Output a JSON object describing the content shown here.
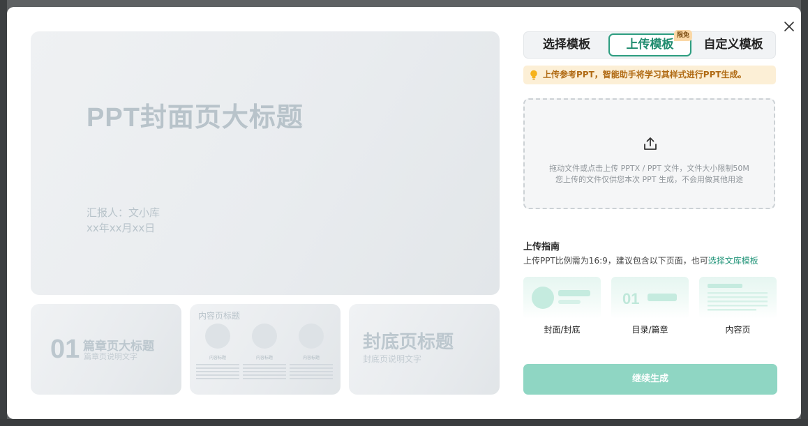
{
  "preview": {
    "cover_title": "PPT封面页大标题",
    "cover_reporter": "汇报人：文小库",
    "cover_date": "xx年xx月xx日",
    "chapter_num": "01",
    "chapter_title": "篇章页大标题",
    "chapter_sub": "篇章页说明文字",
    "content_title": "内容页标题",
    "content_caption": "内容标题",
    "back_title": "封底页标题",
    "back_sub": "封底页说明文字"
  },
  "tabs": {
    "select": "选择模板",
    "upload": "上传模板",
    "custom": "自定义模板",
    "badge": "限免"
  },
  "notice": "上传参考PPT，智能助手将学习其样式进行PPT生成。",
  "dropzone": {
    "line1": "拖动文件或点击上传 PPTX / PPT 文件，文件大小限制50M",
    "line2": "您上传的文件仅供您本次 PPT 生成，不会用做其他用途"
  },
  "guide": {
    "title": "上传指南",
    "desc": "上传PPT比例需为16:9，建议包含以下页面，也可",
    "link": "选择文库模板",
    "cards": [
      "封面/封底",
      "目录/篇章",
      "内容页"
    ],
    "catalog_num": "01"
  },
  "continue_button": "继续生成",
  "colors": {
    "accent": "#2d9d80",
    "button_disabled": "#8fd6c3",
    "notice_bg": "#fcefd6"
  }
}
